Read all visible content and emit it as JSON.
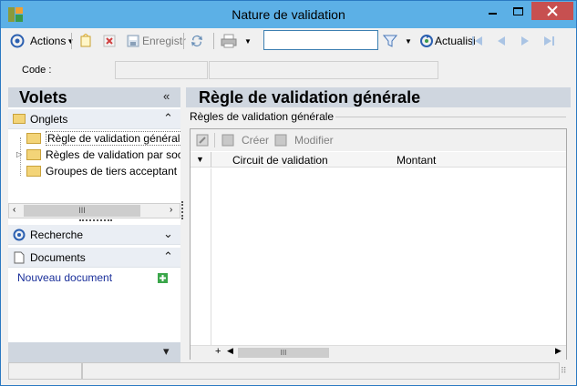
{
  "window": {
    "title": "Nature de validation",
    "accent": "#5cb0e6"
  },
  "toolbar": {
    "actions_label": "Actions",
    "save_label": "Enregistr",
    "search_value": "",
    "refresh_label": "Actualisi"
  },
  "code": {
    "label": "Code :",
    "value": "",
    "description": ""
  },
  "left_panel": {
    "title": "Volets",
    "onglets_label": "Onglets",
    "tree_items": [
      "Règle de validation générale",
      "Règles de validation par soc",
      "Groupes de tiers acceptant l"
    ],
    "recherche_label": "Recherche",
    "documents_label": "Documents",
    "new_document_label": "Nouveau document",
    "scroll_thumb_label": "III"
  },
  "main": {
    "title": "Règle de validation générale",
    "group_title": "Règles de validation générale",
    "create_label": "Créer",
    "modify_label": "Modifier",
    "columns": [
      "Circuit de validation",
      "Montant"
    ],
    "scroll_thumb_label": "III"
  },
  "status": {
    "cell1": "",
    "cell2": ""
  }
}
